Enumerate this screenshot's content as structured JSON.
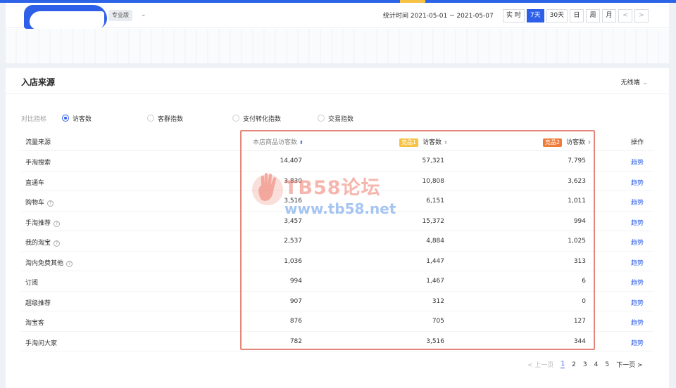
{
  "header": {
    "version_badge": "专业版",
    "stat_time": "统计时间 2021-05-01 ~ 2021-05-07",
    "ranges": [
      "实 时",
      "7天",
      "30天",
      "日",
      "周",
      "月"
    ],
    "active_range": "7天",
    "prev": "<",
    "next": ">"
  },
  "section": {
    "title": "入店来源",
    "terminal": "无线端"
  },
  "compare": {
    "label": "对比指标",
    "options": [
      "访客数",
      "客群指数",
      "支付转化指数",
      "交易指数"
    ],
    "selected": "访客数"
  },
  "table": {
    "headers": {
      "source": "流量来源",
      "own": "本店商品访客数",
      "comp1_tag": "竞品1",
      "comp1": "访客数",
      "comp2_tag": "竞品2",
      "comp2": "访客数",
      "action": "操作"
    },
    "colors": {
      "comp1_tag": "#f6c344",
      "comp2_tag": "#f07c3a",
      "link": "#2e5fe8"
    },
    "rows": [
      {
        "source": "手淘搜索",
        "own": "14,407",
        "comp1": "57,321",
        "comp2": "7,795",
        "action": "趋势"
      },
      {
        "source": "直通车",
        "own": "3,830",
        "comp1": "10,808",
        "comp2": "3,623",
        "action": "趋势"
      },
      {
        "source": "购物车",
        "own": "3,516",
        "comp1": "6,151",
        "comp2": "1,011",
        "action": "趋势"
      },
      {
        "source": "手淘推荐",
        "own": "3,457",
        "comp1": "15,372",
        "comp2": "994",
        "action": "趋势"
      },
      {
        "source": "我的淘宝",
        "own": "2,537",
        "comp1": "4,884",
        "comp2": "1,025",
        "action": "趋势"
      },
      {
        "source": "淘内免费其他",
        "own": "1,036",
        "comp1": "1,447",
        "comp2": "313",
        "action": "趋势"
      },
      {
        "source": "订阅",
        "own": "994",
        "comp1": "1,467",
        "comp2": "6",
        "action": "趋势"
      },
      {
        "source": "超级推荐",
        "own": "907",
        "comp1": "312",
        "comp2": "0",
        "action": "趋势"
      },
      {
        "source": "淘宝客",
        "own": "876",
        "comp1": "705",
        "comp2": "127",
        "action": "趋势"
      },
      {
        "source": "手淘问大家",
        "own": "782",
        "comp1": "3,516",
        "comp2": "344",
        "action": "趋势"
      }
    ]
  },
  "pager": {
    "prev": "< 上一页",
    "pages": [
      "1",
      "2",
      "3",
      "4",
      "5"
    ],
    "current": "1",
    "next": "下一页 >"
  },
  "watermark": {
    "text": "TB58论坛",
    "url": "www.tb58.net"
  }
}
